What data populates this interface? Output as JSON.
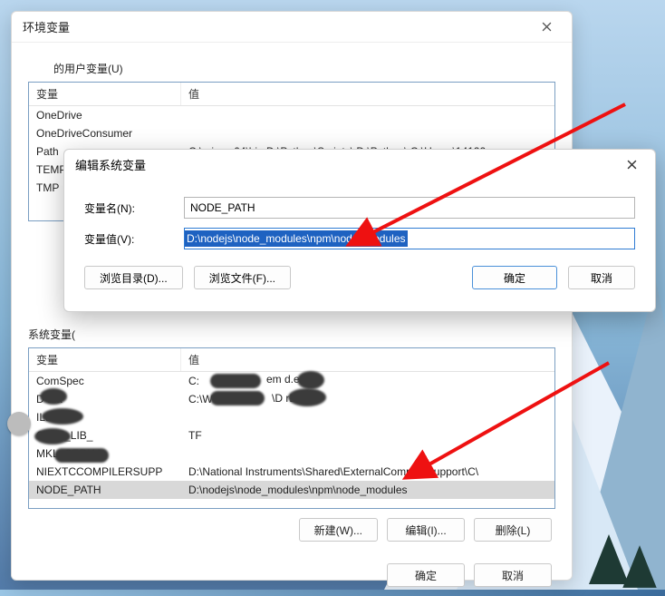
{
  "envWin": {
    "title": "环境变量",
    "close": "×",
    "userLabel": "的用户变量(U)",
    "sysLabel": "系统变量(",
    "colVar": "变量",
    "colVal": "值",
    "userRows": [
      {
        "name": "OneDrive",
        "val": ""
      },
      {
        "name": "OneDriveConsumer",
        "val": ""
      },
      {
        "name": "Path",
        "val": "C:\\mingw64\\bin;D:\\Python\\Scripts\\;D:\\Python\\;C:\\Users\\14122"
      },
      {
        "name": "TEMP",
        "val": ""
      },
      {
        "name": "TMP",
        "val": ""
      }
    ],
    "sysRows": [
      {
        "name": "ComSpec",
        "val": "C:"
      },
      {
        "name": "D            ata",
        "val": "C:\\W"
      },
      {
        "name": "ILB",
        "val": ""
      },
      {
        "name": "             CATE_LIB_",
        "val": "TF"
      },
      {
        "name": "MKL_SERIAL",
        "val": ""
      },
      {
        "name": "NIEXTCCOMPILERSUPP",
        "val": "D:\\National Instruments\\Shared\\ExternalCompilerSupport\\C\\"
      },
      {
        "name": "NODE_PATH",
        "val": "D:\\nodejs\\node_modules\\npm\\node_modules"
      }
    ],
    "sysRowsRemnant1": "em            d.exe",
    "sysRowsRemnant2": "\\D                rData",
    "btn_new": "新建(W)...",
    "btn_edit": "编辑(I)...",
    "btn_del": "删除(L)",
    "btn_ok": "确定",
    "btn_cancel": "取消"
  },
  "editWin": {
    "title": "编辑系统变量",
    "lblName": "变量名(N):",
    "lblVal": "变量值(V):",
    "name": "NODE_PATH",
    "value": "D:\\nodejs\\node_modules\\npm\\node_modules",
    "btn_browseDir": "浏览目录(D)...",
    "btn_browseFile": "浏览文件(F)...",
    "btn_ok": "确定",
    "btn_cancel": "取消"
  }
}
